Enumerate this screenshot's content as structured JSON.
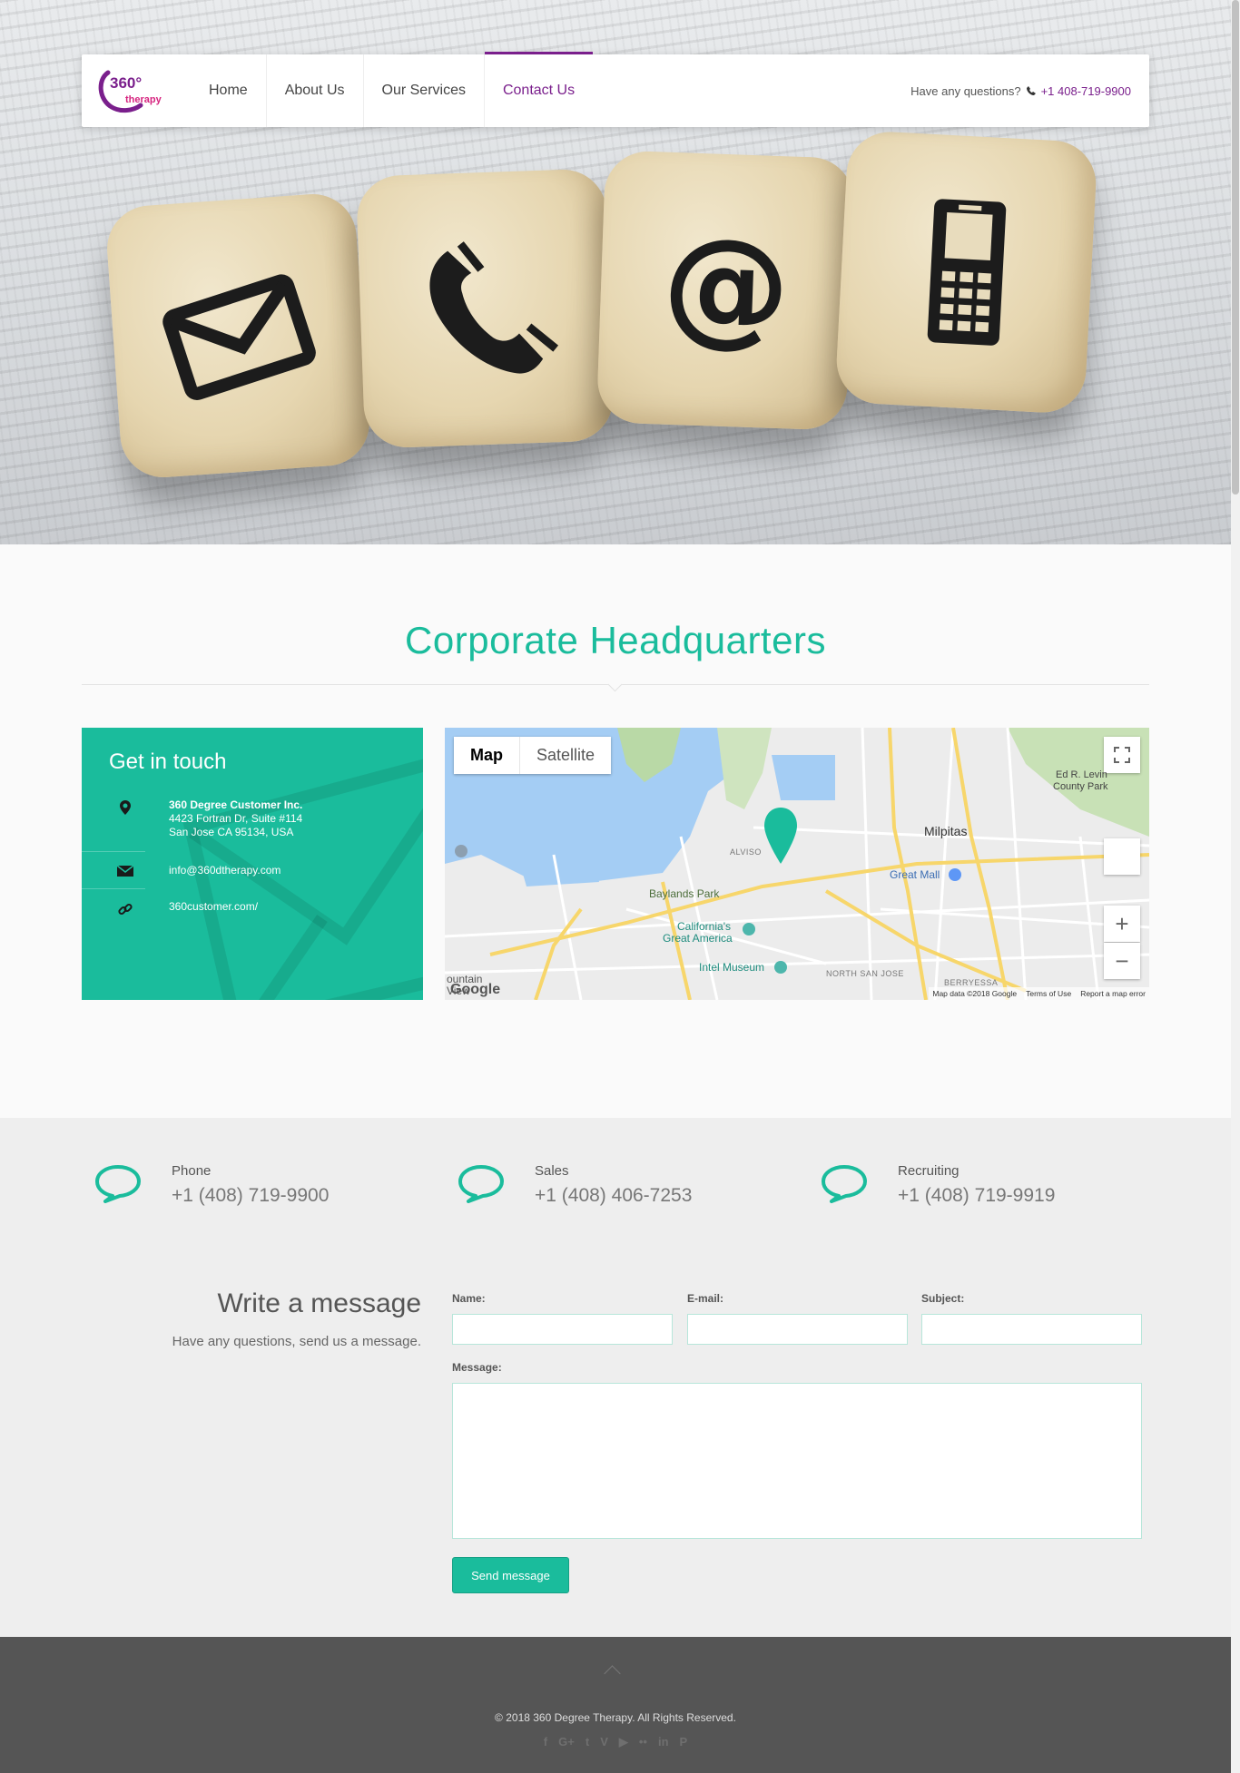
{
  "header": {
    "logo": {
      "top": "360°",
      "bottom": "therapy"
    },
    "nav": [
      {
        "label": "Home",
        "active": false
      },
      {
        "label": "About Us",
        "active": false
      },
      {
        "label": "Our Services",
        "active": false
      },
      {
        "label": "Contact Us",
        "active": true
      }
    ],
    "question": "Have any questions?",
    "phone": "+1 408-719-9900"
  },
  "hq": {
    "title": "Corporate Headquarters"
  },
  "touch": {
    "title": "Get in touch",
    "company": "360 Degree Customer Inc.",
    "address1": "4423 Fortran Dr, Suite #114",
    "address2": "San Jose CA 95134, USA",
    "email": "info@360dtherapy.com",
    "website": "360customer.com/"
  },
  "map": {
    "tabs": [
      "Map",
      "Satellite"
    ],
    "labels": {
      "park": "Ed R. Levin",
      "park2": "County Park",
      "milpitas": "Milpitas",
      "alviso": "ALVISO",
      "greatmall": "Great Mall",
      "baylands": "Baylands Park",
      "ca1": "California's",
      "ca2": "Great America",
      "intel": "Intel Museum",
      "northsj": "NORTH SAN JOSE",
      "berryessa": "BERRYESSA",
      "mtn": "ountain",
      "view": "View"
    },
    "footer": [
      "Map data ©2018 Google",
      "Terms of Use",
      "Report a map error"
    ],
    "google": "Google"
  },
  "contacts": [
    {
      "label": "Phone",
      "value": "+1 (408) 719-9900"
    },
    {
      "label": "Sales",
      "value": "+1 (408) 406-7253"
    },
    {
      "label": "Recruiting",
      "value": "+1 (408) 719-9919"
    }
  ],
  "form": {
    "title": "Write a message",
    "subtitle": "Have any questions, send us a message.",
    "name_label": "Name:",
    "email_label": "E-mail:",
    "subject_label": "Subject:",
    "message_label": "Message:",
    "send_label": "Send message"
  },
  "footer": {
    "copyright": "© 2018 360 Degree Therapy. All Rights Reserved.",
    "social": [
      "f",
      "G+",
      "t",
      "V",
      "▶",
      "••",
      "in",
      "P"
    ]
  },
  "colors": {
    "accent": "#1abc9c",
    "brand": "#7a1f8c",
    "footer": "#555555"
  }
}
